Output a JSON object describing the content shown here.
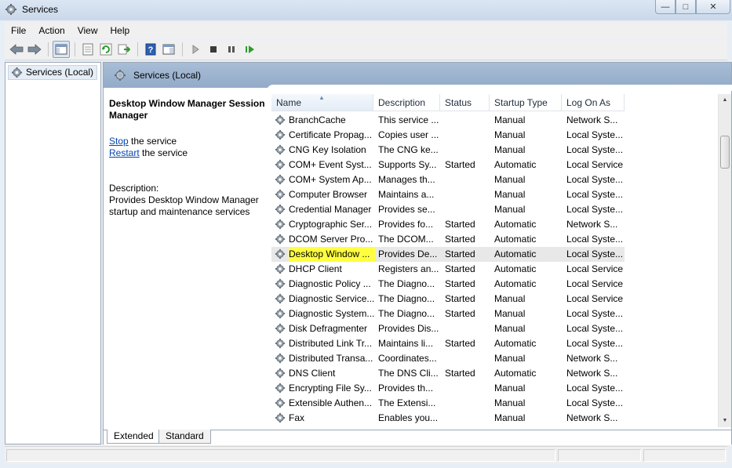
{
  "window": {
    "title": "Services",
    "buttons": {
      "minimize": "—",
      "maximize": "□",
      "close": "✕"
    }
  },
  "menu": [
    "File",
    "Action",
    "View",
    "Help"
  ],
  "toolbar": {
    "icons": [
      "back-icon",
      "forward-icon",
      "show-hide-console-tree-icon",
      "properties-icon",
      "refresh-icon",
      "export-list-icon",
      "help-icon",
      "show-action-pane-icon",
      "start-service-icon",
      "stop-service-icon",
      "pause-service-icon",
      "restart-service-icon"
    ]
  },
  "tree": {
    "item": "Services (Local)"
  },
  "main": {
    "header_title": "Services (Local)",
    "selected_title": "Desktop Window Manager Session Manager",
    "stop_link": "Stop",
    "stop_rest": " the service",
    "restart_link": "Restart",
    "restart_rest": " the service",
    "description_label": "Description:",
    "description_text": "Provides Desktop Window Manager startup and maintenance services"
  },
  "table": {
    "columns": [
      "Name",
      "Description",
      "Status",
      "Startup Type",
      "Log On As"
    ],
    "sorted_column": "Name",
    "rows": [
      {
        "name": "BranchCache",
        "description": "This service ...",
        "status": "",
        "startup": "Manual",
        "logon": "Network S..."
      },
      {
        "name": "Certificate Propag...",
        "description": "Copies user ...",
        "status": "",
        "startup": "Manual",
        "logon": "Local Syste..."
      },
      {
        "name": "CNG Key Isolation",
        "description": "The CNG ke...",
        "status": "",
        "startup": "Manual",
        "logon": "Local Syste..."
      },
      {
        "name": "COM+ Event Syst...",
        "description": "Supports Sy...",
        "status": "Started",
        "startup": "Automatic",
        "logon": "Local Service"
      },
      {
        "name": "COM+ System Ap...",
        "description": "Manages th...",
        "status": "",
        "startup": "Manual",
        "logon": "Local Syste..."
      },
      {
        "name": "Computer Browser",
        "description": "Maintains a...",
        "status": "",
        "startup": "Manual",
        "logon": "Local Syste..."
      },
      {
        "name": "Credential Manager",
        "description": "Provides se...",
        "status": "",
        "startup": "Manual",
        "logon": "Local Syste..."
      },
      {
        "name": "Cryptographic Ser...",
        "description": "Provides fo...",
        "status": "Started",
        "startup": "Automatic",
        "logon": "Network S..."
      },
      {
        "name": "DCOM Server Pro...",
        "description": "The DCOM...",
        "status": "Started",
        "startup": "Automatic",
        "logon": "Local Syste..."
      },
      {
        "name": "Desktop Window ...",
        "description": "Provides De...",
        "status": "Started",
        "startup": "Automatic",
        "logon": "Local Syste..."
      },
      {
        "name": "DHCP Client",
        "description": "Registers an...",
        "status": "Started",
        "startup": "Automatic",
        "logon": "Local Service"
      },
      {
        "name": "Diagnostic Policy ...",
        "description": "The Diagno...",
        "status": "Started",
        "startup": "Automatic",
        "logon": "Local Service"
      },
      {
        "name": "Diagnostic Service...",
        "description": "The Diagno...",
        "status": "Started",
        "startup": "Manual",
        "logon": "Local Service"
      },
      {
        "name": "Diagnostic System...",
        "description": "The Diagno...",
        "status": "Started",
        "startup": "Manual",
        "logon": "Local Syste..."
      },
      {
        "name": "Disk Defragmenter",
        "description": "Provides Dis...",
        "status": "",
        "startup": "Manual",
        "logon": "Local Syste..."
      },
      {
        "name": "Distributed Link Tr...",
        "description": "Maintains li...",
        "status": "Started",
        "startup": "Automatic",
        "logon": "Local Syste..."
      },
      {
        "name": "Distributed Transa...",
        "description": "Coordinates...",
        "status": "",
        "startup": "Manual",
        "logon": "Network S..."
      },
      {
        "name": "DNS Client",
        "description": "The DNS Cli...",
        "status": "Started",
        "startup": "Automatic",
        "logon": "Network S..."
      },
      {
        "name": "Encrypting File Sy...",
        "description": "Provides th...",
        "status": "",
        "startup": "Manual",
        "logon": "Local Syste..."
      },
      {
        "name": "Extensible Authen...",
        "description": "The Extensi...",
        "status": "",
        "startup": "Manual",
        "logon": "Local Syste..."
      },
      {
        "name": "Fax",
        "description": "Enables you...",
        "status": "",
        "startup": "Manual",
        "logon": "Network S..."
      }
    ]
  },
  "tabs": [
    "Extended",
    "Standard"
  ],
  "colors": {
    "highlight": "#ffff40",
    "header": "#9fb5d0",
    "link": "#0645ad"
  }
}
